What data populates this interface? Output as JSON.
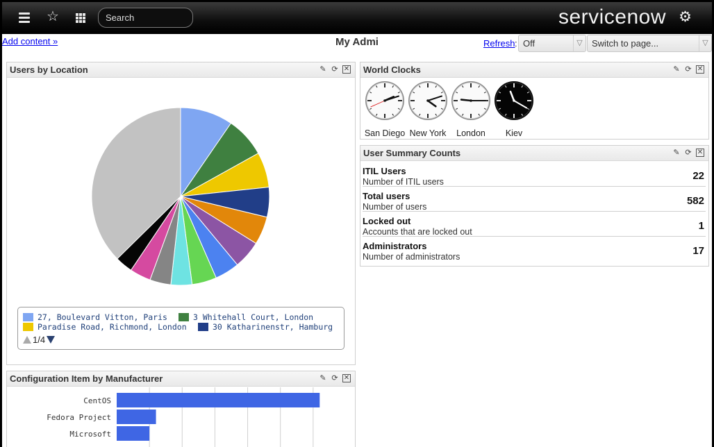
{
  "topbar": {
    "search_placeholder": "Search",
    "brand": "servicenow"
  },
  "header": {
    "add_content": "Add content »",
    "title": "My Admi",
    "refresh_label": "Refresh",
    "refresh_value": "Off",
    "switch_page": "Switch to page..."
  },
  "widgets": {
    "users_by_location": {
      "title": "Users by Location",
      "legend": [
        {
          "label": "27, Boulevard Vitton, Paris",
          "color": "#7fa6f2"
        },
        {
          "label": "3 Whitehall Court, London",
          "color": "#3f8040"
        },
        {
          "label": "Paradise Road, Richmond, London",
          "color": "#eec800"
        },
        {
          "label": "30 Katharinenstr, Hamburg",
          "color": "#213e88"
        }
      ],
      "pager": "1/4"
    },
    "world_clocks": {
      "title": "World Clocks",
      "clocks": [
        {
          "label": "San Diego",
          "dark": false,
          "hour": 2.2,
          "minute": 12,
          "second": 41
        },
        {
          "label": "New York",
          "dark": false,
          "hour": 4.2,
          "minute": 12,
          "second": null
        },
        {
          "label": "London",
          "dark": false,
          "hour": 9.2,
          "minute": 15,
          "second": null
        },
        {
          "label": "Kiev",
          "dark": true,
          "hour": 11.3,
          "minute": 20,
          "second": null
        }
      ]
    },
    "user_summary": {
      "title": "User Summary Counts",
      "rows": [
        {
          "title": "ITIL Users",
          "desc": "Number of ITIL users",
          "count": "22"
        },
        {
          "title": "Total users",
          "desc": "Number of users",
          "count": "582"
        },
        {
          "title": "Locked out",
          "desc": "Accounts that are locked out",
          "count": "1"
        },
        {
          "title": "Administrators",
          "desc": "Number of administrators",
          "count": "17"
        }
      ]
    },
    "config_items": {
      "title": "Configuration Item by Manufacturer"
    }
  },
  "chart_data": [
    {
      "type": "pie",
      "title": "Users by Location",
      "slices": [
        {
          "label": "27, Boulevard Vitton, Paris",
          "value": 30,
          "color": "#7fa6f2"
        },
        {
          "label": "3 Whitehall Court, London",
          "value": 23,
          "color": "#3f8040"
        },
        {
          "label": "Paradise Road, Richmond, London",
          "value": 20,
          "color": "#eec800"
        },
        {
          "label": "30 Katharinenstr, Hamburg",
          "value": 17,
          "color": "#213e88"
        },
        {
          "value": 16,
          "color": "#e2870a"
        },
        {
          "value": 16,
          "color": "#8c55a4"
        },
        {
          "value": 14,
          "color": "#4c82f0"
        },
        {
          "value": 14,
          "color": "#66d653"
        },
        {
          "value": 12,
          "color": "#6ee3e2"
        },
        {
          "value": 12,
          "color": "#858585"
        },
        {
          "value": 12,
          "color": "#d54aa0"
        },
        {
          "value": 10,
          "color": "#050505"
        },
        {
          "value": 117,
          "color": "#c2c2c2"
        }
      ]
    },
    {
      "type": "bar",
      "title": "Configuration Item by Manufacturer",
      "orientation": "horizontal",
      "categories": [
        "CentOS",
        "Fedora Project",
        "Microsoft"
      ],
      "values": [
        62,
        12,
        10
      ],
      "color": "#3f66e4",
      "xlim": [
        0,
        70
      ],
      "grid": true
    }
  ]
}
